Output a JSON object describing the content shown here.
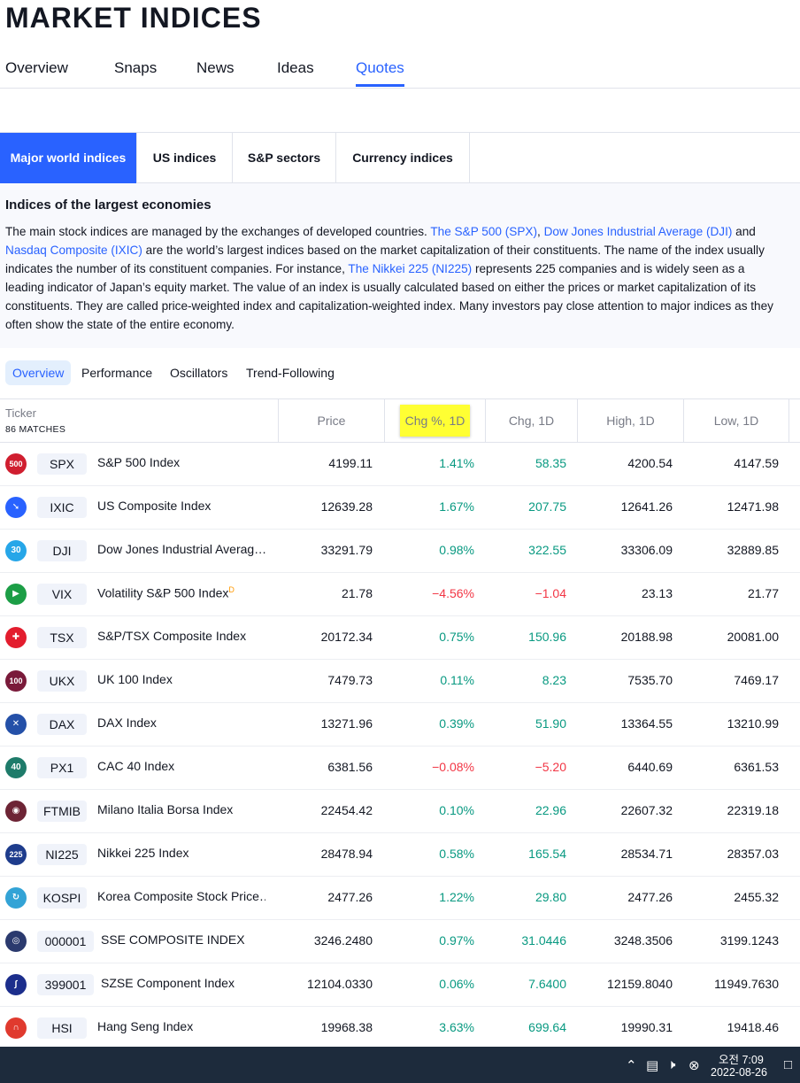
{
  "page_title": "MARKET INDICES",
  "nav_tabs": [
    "Overview",
    "Snaps",
    "News",
    "Ideas",
    "Quotes"
  ],
  "category_tabs": [
    "Major world indices",
    "US indices",
    "S&P sectors",
    "Currency indices"
  ],
  "description": {
    "title": "Indices of the largest economies",
    "t1": "The main stock indices are managed by the exchanges of developed countries. ",
    "l1": "The S&P 500 (SPX)",
    "t2": ", ",
    "l2": "Dow Jones Industrial Average (DJI)",
    "t3": " and ",
    "l3": "Nasdaq Composite (IXIC)",
    "t4": " are the world’s largest indices based on the market capitalization of their constituents. The name of the index usually indicates the number of its constituent companies. For instance, ",
    "l4": "The Nikkei 225 (NI225)",
    "t5": " represents 225 companies and is widely seen as a leading indicator of Japan’s equity market. The value of an index is usually calculated based on either the prices or market capitalization of its constituents. They are called price-weighted index and capitalization-weighted index. Many investors pay close attention to major indices as they often show the state of the entire economy."
  },
  "sub_tabs": [
    "Overview",
    "Performance",
    "Oscillators",
    "Trend-Following"
  ],
  "table": {
    "ticker_label": "Ticker",
    "matches": "86 MATCHES",
    "columns": [
      "Price",
      "Chg %, 1D",
      "Chg, 1D",
      "High, 1D",
      "Low, 1D"
    ],
    "rows": [
      {
        "logo": "500",
        "symbol": "SPX",
        "name": "S&P 500 Index",
        "price": "4199.11",
        "chg_pct": "1.41%",
        "chg": "58.35",
        "high": "4200.54",
        "low": "4147.59"
      },
      {
        "logo": "",
        "symbol": "IXIC",
        "name": "US Composite Index",
        "price": "12639.28",
        "chg_pct": "1.67%",
        "chg": "207.75",
        "high": "12641.26",
        "low": "12471.98"
      },
      {
        "logo": "30",
        "symbol": "DJI",
        "name": "Dow Jones Industrial Averag…",
        "price": "33291.79",
        "chg_pct": "0.98%",
        "chg": "322.55",
        "high": "33306.09",
        "low": "32889.85"
      },
      {
        "logo": "",
        "symbol": "VIX",
        "name": "Volatility S&P 500 Index",
        "price": "21.78",
        "chg_pct": "−4.56%",
        "chg": "−1.04",
        "high": "23.13",
        "low": "21.77",
        "badge": "D"
      },
      {
        "logo": "",
        "symbol": "TSX",
        "name": "S&P/TSX Composite Index",
        "price": "20172.34",
        "chg_pct": "0.75%",
        "chg": "150.96",
        "high": "20188.98",
        "low": "20081.00"
      },
      {
        "logo": "100",
        "symbol": "UKX",
        "name": "UK 100 Index",
        "price": "7479.73",
        "chg_pct": "0.11%",
        "chg": "8.23",
        "high": "7535.70",
        "low": "7469.17"
      },
      {
        "logo": "",
        "symbol": "DAX",
        "name": "DAX Index",
        "price": "13271.96",
        "chg_pct": "0.39%",
        "chg": "51.90",
        "high": "13364.55",
        "low": "13210.99"
      },
      {
        "logo": "40",
        "symbol": "PX1",
        "name": "CAC 40 Index",
        "price": "6381.56",
        "chg_pct": "−0.08%",
        "chg": "−5.20",
        "high": "6440.69",
        "low": "6361.53"
      },
      {
        "logo": "",
        "symbol": "FTMIB",
        "name": "Milano Italia Borsa Index",
        "price": "22454.42",
        "chg_pct": "0.10%",
        "chg": "22.96",
        "high": "22607.32",
        "low": "22319.18"
      },
      {
        "logo": "225",
        "symbol": "NI225",
        "name": "Nikkei 225 Index",
        "price": "28478.94",
        "chg_pct": "0.58%",
        "chg": "165.54",
        "high": "28534.71",
        "low": "28357.03"
      },
      {
        "logo": "",
        "symbol": "KOSPI",
        "name": "Korea Composite Stock Price…",
        "price": "2477.26",
        "chg_pct": "1.22%",
        "chg": "29.80",
        "high": "2477.26",
        "low": "2455.32"
      },
      {
        "logo": "",
        "symbol": "000001",
        "name": "SSE COMPOSITE INDEX",
        "price": "3246.2480",
        "chg_pct": "0.97%",
        "chg": "31.0446",
        "high": "3248.3506",
        "low": "3199.1243"
      },
      {
        "logo": "",
        "symbol": "399001",
        "name": "SZSE Component Index",
        "price": "12104.0330",
        "chg_pct": "0.06%",
        "chg": "7.6400",
        "high": "12159.8040",
        "low": "11949.7630"
      },
      {
        "logo": "",
        "symbol": "HSI",
        "name": "Hang Seng Index",
        "price": "19968.38",
        "chg_pct": "3.63%",
        "chg": "699.64",
        "high": "19990.31",
        "low": "19418.46"
      }
    ]
  },
  "taskbar": {
    "time": "오전 7:09",
    "date": "2022-08-26"
  },
  "colors": {
    "accent": "#2962ff",
    "positive": "#089981",
    "negative": "#f23645",
    "highlight": "#ffff33",
    "taskbar": "#1d2b3c"
  }
}
